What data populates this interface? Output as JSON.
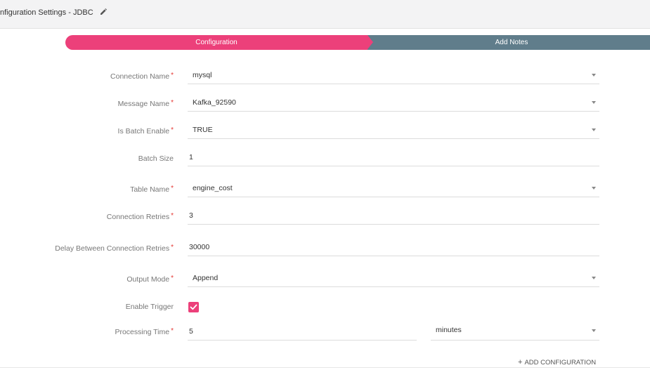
{
  "header": {
    "title": "nfiguration Settings -  JDBC"
  },
  "stepper": {
    "steps": [
      {
        "label": "Configuration"
      },
      {
        "label": "Add Notes"
      }
    ]
  },
  "form": {
    "connection_name": {
      "label": "Connection Name",
      "value": "mysql"
    },
    "message_name": {
      "label": "Message Name",
      "value": "Kafka_92590"
    },
    "is_batch_enable": {
      "label": "Is Batch Enable",
      "value": "TRUE"
    },
    "batch_size": {
      "label": "Batch Size",
      "value": "1"
    },
    "table_name": {
      "label": "Table Name",
      "value": "engine_cost"
    },
    "connection_retries": {
      "label": "Connection Retries",
      "value": "3"
    },
    "delay_between_retries": {
      "label": "Delay Between Connection Retries",
      "value": "30000"
    },
    "output_mode": {
      "label": "Output Mode",
      "value": "Append"
    },
    "enable_trigger": {
      "label": "Enable Trigger",
      "checked": true
    },
    "processing_time": {
      "label": "Processing Time",
      "value": "5",
      "unit": "minutes"
    },
    "required_marker": "*"
  },
  "actions": {
    "add_configuration_plus": "+",
    "add_configuration": "ADD CONFIGURATION"
  },
  "colors": {
    "accent": "#ec407a",
    "inactive_step": "#607d8b",
    "required": "#e53935"
  }
}
